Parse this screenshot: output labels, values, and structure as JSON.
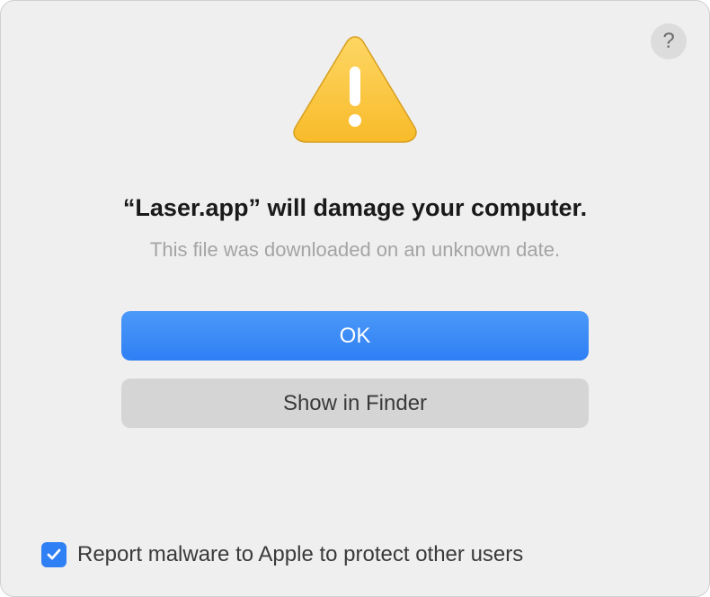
{
  "dialog": {
    "app_name": "Laser.app",
    "title": "“Laser.app” will damage your computer.",
    "subtitle": "This file was downloaded on an unknown date.",
    "help_label": "?",
    "buttons": {
      "ok": "OK",
      "show_in_finder": "Show in Finder"
    },
    "checkbox": {
      "checked": true,
      "label": "Report malware to Apple to protect other users"
    }
  },
  "colors": {
    "primary": "#2f7ff5",
    "warning_fill": "#fccc3e",
    "warning_stroke": "#dca826"
  }
}
